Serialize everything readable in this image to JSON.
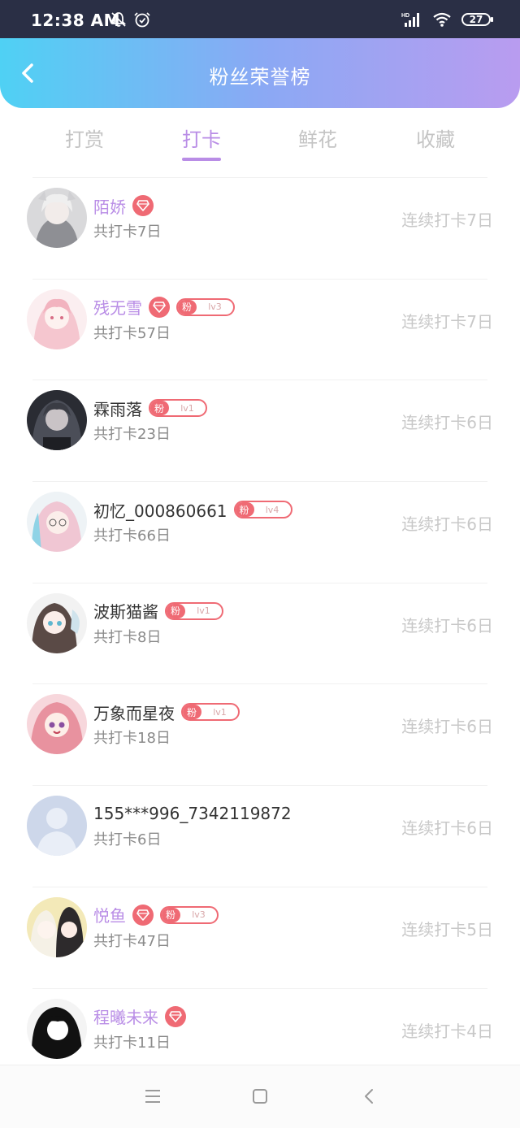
{
  "status": {
    "time": "12:38 AM",
    "battery": "27"
  },
  "header": {
    "title": "粉丝荣誉榜"
  },
  "tabs": [
    {
      "label": "打赏",
      "active": false
    },
    {
      "label": "打卡",
      "active": true
    },
    {
      "label": "鲜花",
      "active": false
    },
    {
      "label": "收藏",
      "active": false
    }
  ],
  "colors": {
    "accent": "#b98de6",
    "badge": "#ef6a74",
    "header_from": "#4fd1f4",
    "header_to": "#b99cf0"
  },
  "rows": [
    {
      "name": "陌娇",
      "vip": true,
      "fan_level": null,
      "total": "共打卡7日",
      "streak": "连续打卡7日"
    },
    {
      "name": "残无雪",
      "vip": true,
      "fan_level": "lv3",
      "total": "共打卡57日",
      "streak": "连续打卡7日"
    },
    {
      "name": "霖雨落",
      "vip": false,
      "fan_level": "lv1",
      "total": "共打卡23日",
      "streak": "连续打卡6日"
    },
    {
      "name": "初忆_000860661",
      "vip": false,
      "fan_level": "lv4",
      "total": "共打卡66日",
      "streak": "连续打卡6日"
    },
    {
      "name": "波斯猫酱",
      "vip": false,
      "fan_level": "lv1",
      "total": "共打卡8日",
      "streak": "连续打卡6日"
    },
    {
      "name": "万象而星夜",
      "vip": false,
      "fan_level": "lv1",
      "total": "共打卡18日",
      "streak": "连续打卡6日"
    },
    {
      "name": "155***996_7342119872",
      "vip": false,
      "fan_level": null,
      "total": "共打卡6日",
      "streak": "连续打卡6日"
    },
    {
      "name": "悦鱼",
      "vip": true,
      "fan_level": "lv3",
      "total": "共打卡47日",
      "streak": "连续打卡5日"
    },
    {
      "name": "程曦未来",
      "vip": true,
      "fan_level": null,
      "total": "共打卡11日",
      "streak": "连续打卡4日"
    }
  ],
  "fan_badge_label": "粉",
  "navbar": {
    "icons": [
      "menu-icon",
      "home-square-icon",
      "back-triangle-icon"
    ]
  }
}
